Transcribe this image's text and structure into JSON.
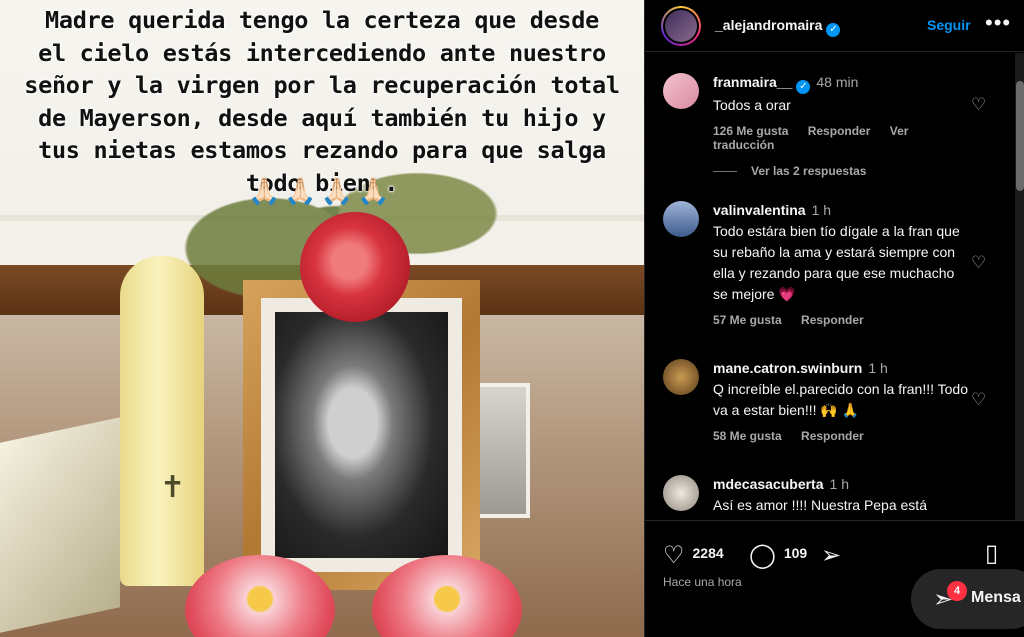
{
  "post": {
    "caption_lines": [
      "Madre querida tengo la certeza que desde",
      "el cielo estás intercediendo ante nuestro",
      "señor y la virgen  por la recuperación total",
      "de Mayerson, desde aquí también tu hijo y",
      "tus nietas estamos rezando para que salga",
      "todo bien ."
    ],
    "caption_emojis": "🙏🏻🙏🏻🙏🏻🙏🏻"
  },
  "header": {
    "username": "_alejandromaira",
    "verified_icon": "verified-badge-icon",
    "follow_label": "Seguir",
    "more_icon": "more-options-icon"
  },
  "comments": [
    {
      "username": "franmaira__",
      "verified": true,
      "time": "48 min",
      "text": "Todos a orar",
      "likes": "126 Me gusta",
      "reply_label": "Responder",
      "translate_label": "Ver traducción",
      "view_replies": "Ver las 2 respuestas",
      "avatar_color": "#e7a7b6"
    },
    {
      "username": "valinvalentina",
      "verified": false,
      "time": "1 h",
      "text": "Todo estára bien tío dígale a la fran que su rebaño la ama y estará siempre con ella y rezando para que ese muchacho se mejore 💗",
      "likes": "57 Me gusta",
      "reply_label": "Responder",
      "avatar_color": "#6d86b8"
    },
    {
      "username": "mane.catron.swinburn",
      "verified": false,
      "time": "1 h",
      "text": "Q increíble el.parecido con la fran!!! Todo va a estar bien!!! 🙌 🙏",
      "likes": "58 Me gusta",
      "reply_label": "Responder",
      "avatar_color": "#a57a3a"
    },
    {
      "username": "mdecasacuberta",
      "verified": false,
      "time": "1 h",
      "text": "Así es amor !!!! Nuestra Pepa está",
      "avatar_color": "#c9c2b6"
    }
  ],
  "actions": {
    "like_icon": "heart-icon",
    "like_count": "2284",
    "comment_icon": "comment-icon",
    "comment_count": "109",
    "share_icon": "share-icon",
    "save_icon": "bookmark-icon",
    "posted_time": "Hace una hora"
  },
  "messages": {
    "icon": "messenger-icon",
    "badge_count": "4",
    "label": "Mensa"
  },
  "colors": {
    "accent_blue": "#0095f6",
    "badge_red": "#ff3040",
    "secondary_text": "#a8a8a8"
  }
}
